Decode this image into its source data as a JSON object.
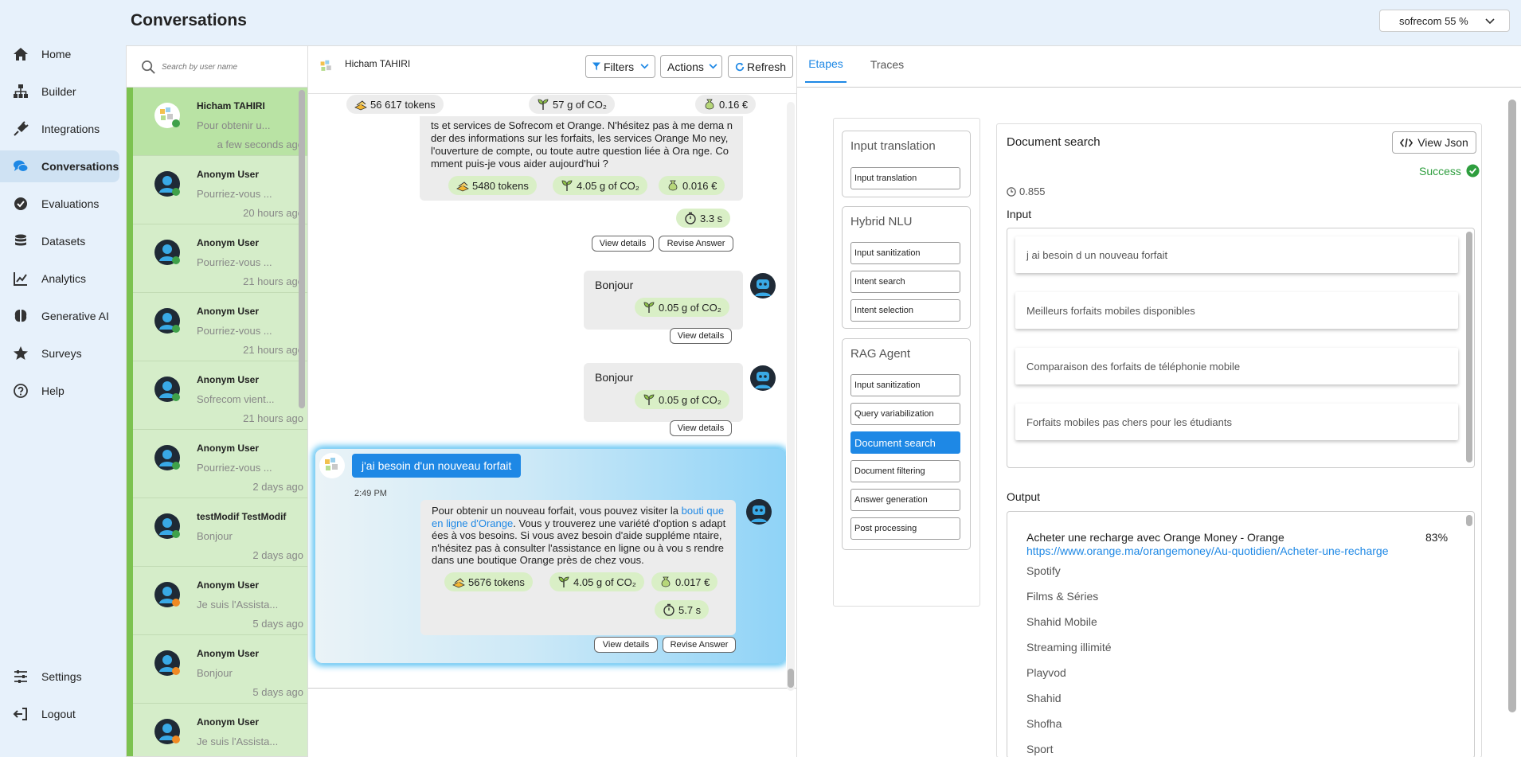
{
  "header": {
    "title": "Conversations",
    "org_select": "sofrecom 55 %"
  },
  "nav": {
    "items": [
      {
        "label": "Home",
        "icon": "home-icon"
      },
      {
        "label": "Builder",
        "icon": "builder-icon"
      },
      {
        "label": "Integrations",
        "icon": "plug-icon"
      },
      {
        "label": "Conversations",
        "icon": "chat-icon",
        "active": true
      },
      {
        "label": "Evaluations",
        "icon": "check-circle-icon"
      },
      {
        "label": "Datasets",
        "icon": "database-icon"
      },
      {
        "label": "Analytics",
        "icon": "chart-line-icon"
      },
      {
        "label": "Generative AI",
        "icon": "brain-icon"
      },
      {
        "label": "Surveys",
        "icon": "star-icon"
      },
      {
        "label": "Help",
        "icon": "help-icon"
      }
    ],
    "bottom": [
      {
        "label": "Settings",
        "icon": "sliders-icon"
      },
      {
        "label": "Logout",
        "icon": "logout-icon"
      }
    ]
  },
  "search": {
    "placeholder": "Search by user name"
  },
  "conversations": [
    {
      "name": "Hicham TAHIRI",
      "preview": "Pour obtenir u...",
      "time": "a few seconds ago",
      "selected": true
    },
    {
      "name": "Anonym User",
      "preview": "Pourriez-vous ...",
      "time": "20 hours ago"
    },
    {
      "name": "Anonym User",
      "preview": "Pourriez-vous ...",
      "time": "21 hours ago"
    },
    {
      "name": "Anonym User",
      "preview": "Pourriez-vous ...",
      "time": "21 hours ago"
    },
    {
      "name": "Anonym User",
      "preview": "Sofrecom vient...",
      "time": "21 hours ago"
    },
    {
      "name": "Anonym User",
      "preview": "Pourriez-vous ...",
      "time": "2 days ago"
    },
    {
      "name": "testModif TestModif",
      "preview": "Bonjour",
      "time": "2 days ago"
    },
    {
      "name": "Anonym User",
      "preview": "Je suis l'Assista...",
      "time": "5 days ago"
    },
    {
      "name": "Anonym User",
      "preview": "Bonjour",
      "time": "5 days ago"
    },
    {
      "name": "Anonym User",
      "preview": "Je suis l'Assista...",
      "time": ""
    }
  ],
  "chat": {
    "user_name": "Hicham TAHIRI",
    "filters_label": "Filters",
    "actions_label": "Actions",
    "refresh_label": "Refresh",
    "totals": {
      "tokens": "56 617 tokens",
      "co2": "57 g of CO₂",
      "cost": "0.16 €"
    },
    "msg1": {
      "text": "ts et services de Sofrecom et Orange. N'hésitez pas à me dema nder des informations sur les forfaits, les services Orange Mo ney, l'ouverture de compte, ou toute autre question liée à Ora nge. Comment puis-je vous aider aujourd'hui ?",
      "tokens": "5480 tokens",
      "co2": "4.05 g of CO₂",
      "cost": "0.016 €",
      "time": "3.3 s"
    },
    "msg2": {
      "text": "Bonjour",
      "co2": "0.05 g of CO₂"
    },
    "msg3": {
      "text": "Bonjour",
      "co2": "0.05 g of CO₂"
    },
    "user_msg": {
      "text": "j'ai besoin d'un nouveau forfait",
      "time": "2:49 PM"
    },
    "answer": {
      "text_before": "Pour obtenir un nouveau forfait, vous pouvez visiter la ",
      "link": "bouti que en ligne d'Orange",
      "text_after": ". Vous y trouverez une variété d'option s adaptées à vos besoins. Si vous avez besoin d'aide suppléme ntaire, n'hésitez pas à consulter l'assistance en ligne ou à vou s rendre dans une boutique Orange près de chez vous.",
      "tokens": "5676 tokens",
      "co2": "4.05 g of CO₂",
      "cost": "0.017 €",
      "time": "5.7 s"
    },
    "view_details": "View details",
    "revise_answer": "Revise Answer"
  },
  "tabs": {
    "etapes": "Etapes",
    "traces": "Traces"
  },
  "pipeline": {
    "groups": [
      {
        "title": "Input translation",
        "steps": [
          "Input translation"
        ]
      },
      {
        "title": "Hybrid NLU",
        "steps": [
          "Input sanitization",
          "Intent search",
          "Intent selection"
        ]
      },
      {
        "title": "RAG Agent",
        "steps": [
          "Input sanitization",
          "Query variabilization",
          "Document search",
          "Document filtering",
          "Answer generation",
          "Post processing"
        ]
      }
    ],
    "selected_step": "Document search"
  },
  "detail": {
    "title": "Document search",
    "view_json": "View Json",
    "status": "Success",
    "duration": "0.855",
    "input_label": "Input",
    "inputs": [
      "j ai besoin d un nouveau forfait",
      "Meilleurs forfaits mobiles disponibles",
      "Comparaison des forfaits de téléphonie mobile",
      "Forfaits mobiles pas chers pour les étudiants"
    ],
    "output_label": "Output",
    "output": {
      "title": "Acheter une recharge avec Orange Money - Orange",
      "score": "83%",
      "url": "https://www.orange.ma/orangemoney/Au-quotidien/Acheter-une-recharge",
      "lines": [
        "Spotify",
        "Films & Séries",
        "Shahid Mobile",
        "Streaming illimité",
        "Playvod",
        "Shahid",
        "Shofha",
        "Sport"
      ]
    }
  },
  "colors": {
    "accent": "#1e88e5",
    "success": "#2e9e3e",
    "conv_bg": "#d5edc9",
    "chip_bg": "#d9efc6",
    "link": "#1e88e5"
  }
}
